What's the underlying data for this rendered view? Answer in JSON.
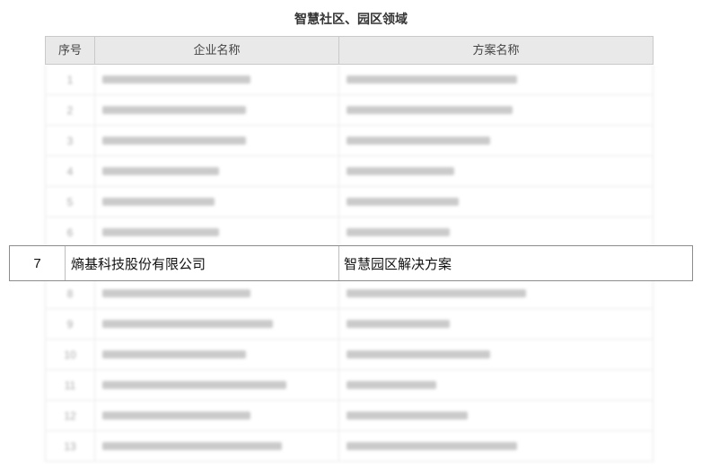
{
  "title": "智慧社区、园区领域",
  "table": {
    "headers": {
      "no": "序号",
      "company": "企业名称",
      "solution": "方案名称"
    },
    "blurred_rows": [
      {
        "no": "1"
      },
      {
        "no": "2"
      },
      {
        "no": "3"
      },
      {
        "no": "4"
      },
      {
        "no": "5"
      },
      {
        "no": "6"
      },
      {
        "no": "8"
      },
      {
        "no": "9"
      },
      {
        "no": "10"
      },
      {
        "no": "11"
      },
      {
        "no": "12"
      },
      {
        "no": "13"
      }
    ]
  },
  "highlight": {
    "no": "7",
    "company": "熵基科技股份有限公司",
    "solution": "智慧园区解决方案"
  }
}
